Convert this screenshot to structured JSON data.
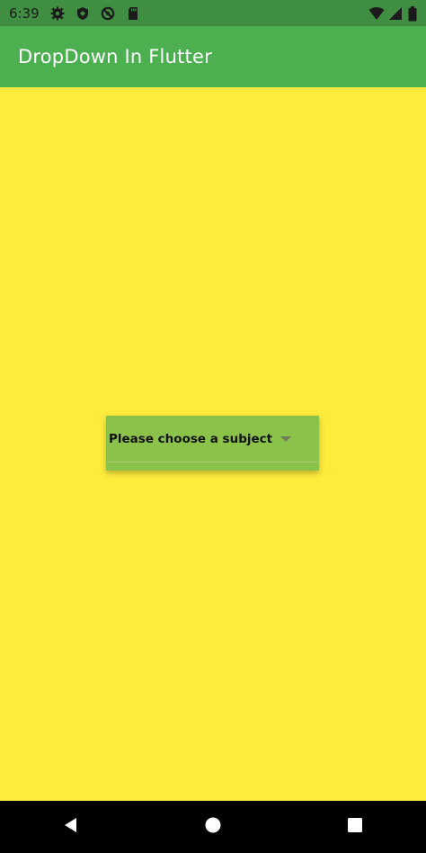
{
  "status_bar": {
    "time": "6:39",
    "icons": [
      "gear-icon",
      "shield-icon",
      "blocked-circle-icon",
      "sd-card-icon",
      "wifi-icon",
      "signal-icon",
      "battery-icon"
    ]
  },
  "app_bar": {
    "title": "DropDown In Flutter"
  },
  "dropdown": {
    "hint": "Please choose a subject",
    "arrow_icon": "arrow-drop-down-icon"
  },
  "nav_bar": {
    "icons": [
      "back-icon",
      "home-icon",
      "recents-icon"
    ]
  },
  "colors": {
    "status_bar": "#3F8E41",
    "app_bar": "#4CAF50",
    "background": "#FFEB3B",
    "dropdown": "#8BC34A",
    "nav_bar": "#000000"
  }
}
